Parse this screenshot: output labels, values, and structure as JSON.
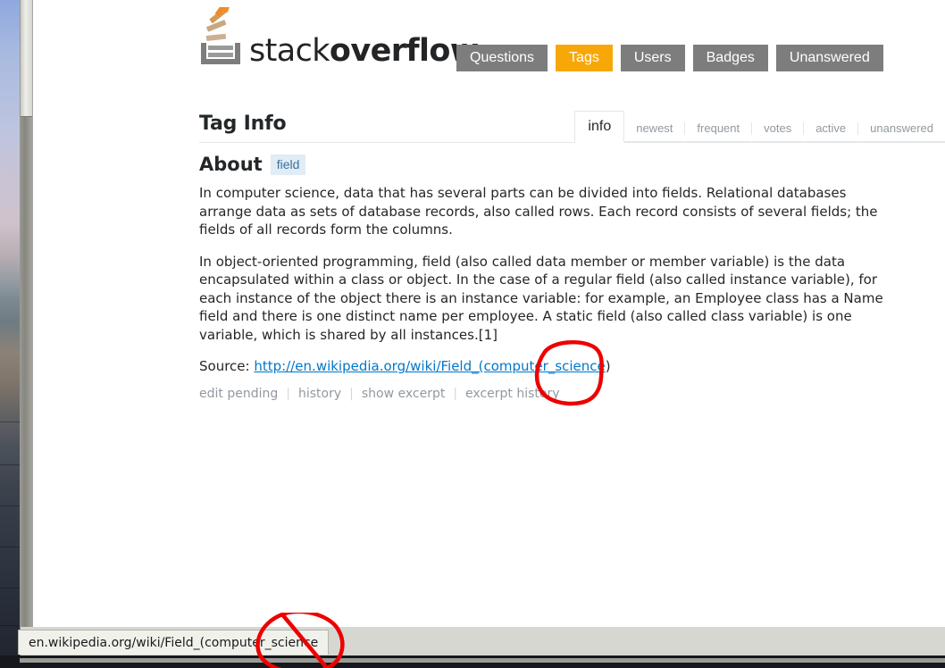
{
  "window": {
    "status_bar_text": "en.wikipedia.org/wiki/Field_(computer_science"
  },
  "header": {
    "logo_text_light": "stack",
    "logo_text_bold": "overflow",
    "logo_icon": "stackoverflow-logo-icon",
    "nav": [
      {
        "label": "Questions",
        "active": false
      },
      {
        "label": "Tags",
        "active": true
      },
      {
        "label": "Users",
        "active": false
      },
      {
        "label": "Badges",
        "active": false
      },
      {
        "label": "Unanswered",
        "active": false
      }
    ]
  },
  "taginfo": {
    "title": "Tag Info",
    "tabs": [
      {
        "label": "info",
        "active": true
      },
      {
        "label": "newest",
        "active": false
      },
      {
        "label": "frequent",
        "active": false
      },
      {
        "label": "votes",
        "active": false
      },
      {
        "label": "active",
        "active": false
      },
      {
        "label": "unanswered",
        "active": false
      }
    ]
  },
  "about": {
    "heading": "About",
    "tag": "field",
    "paragraphs": [
      "In computer science, data that has several parts can be divided into fields. Relational databases arrange data as sets of database records, also called rows. Each record consists of several fields; the fields of all records form the columns.",
      "In object-oriented programming, field (also called data member or member variable) is the data encapsulated within a class or object. In the case of a regular field (also called instance variable), for each instance of the object there is an instance variable: for example, an Employee class has a Name field and there is one distinct name per employee. A static field (also called class variable) is one variable, which is shared by all instances.[1]"
    ],
    "source_label": "Source:",
    "source_link_text": "http://en.wikipedia.org/wiki/Field_(computer_science",
    "source_trailing": ")",
    "actions": [
      {
        "label": "edit pending"
      },
      {
        "label": "history"
      },
      {
        "label": "show excerpt"
      },
      {
        "label": "excerpt history"
      }
    ],
    "action_separator": "|"
  },
  "annotations": {
    "color": "#ee0000",
    "circles": [
      {
        "name": "annotation-circle-source-link"
      },
      {
        "name": "annotation-circle-status-bar"
      }
    ]
  },
  "colors": {
    "accent_orange": "#f7a808",
    "nav_gray": "#7d7d7d",
    "link_blue": "#0077cc",
    "tag_bg": "#e1ecf4",
    "tag_text": "#39739d",
    "muted_text": "#9199a1",
    "annotation_red": "#ee0000"
  }
}
